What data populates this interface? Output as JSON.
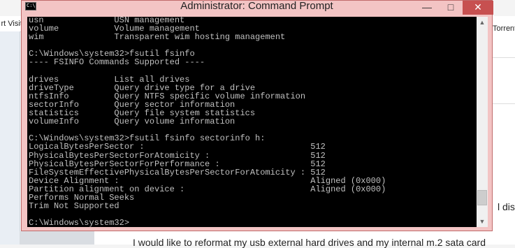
{
  "background": {
    "left_tab_text": "rt Visite",
    "right_tab_text": "Torrent",
    "right_text": "l disk",
    "bottom_text": "I would like to reformat my usb external hard drives and my internal m.2 sata card"
  },
  "window": {
    "title": "Administrator: Command Prompt",
    "icon_text": "C:\\",
    "minimize_icon": "minimize-icon",
    "maximize_icon": "maximize-icon",
    "close_icon": "close-icon"
  },
  "console": {
    "lines": [
      "usn              USN management",
      "volume           Volume management",
      "wim              Transparent wim hosting management",
      "",
      "C:\\Windows\\system32>fsutil fsinfo",
      "---- FSINFO Commands Supported ----",
      "",
      "drives           List all drives",
      "driveType        Query drive type for a drive",
      "ntfsInfo         Query NTFS specific volume information",
      "sectorInfo       Query sector information",
      "statistics       Query file system statistics",
      "volumeInfo       Query volume information",
      "",
      "C:\\Windows\\system32>fsutil fsinfo sectorinfo h:",
      "LogicalBytesPerSector :                                 512",
      "PhysicalBytesPerSectorForAtomicity :                    512",
      "PhysicalBytesPerSectorForPerformance :                  512",
      "FileSystemEffectivePhysicalBytesPerSectorForAtomicity : 512",
      "Device Alignment :                                      Aligned (0x000)",
      "Partition alignment on device :                         Aligned (0x000)",
      "Performs Normal Seeks",
      "Trim Not Supported",
      "",
      "C:\\Windows\\system32>"
    ]
  },
  "colors": {
    "titlebar_bg": "#f3c4c4",
    "close_button": "#c75050",
    "console_bg": "#000000",
    "console_text": "#c0c0c0"
  }
}
